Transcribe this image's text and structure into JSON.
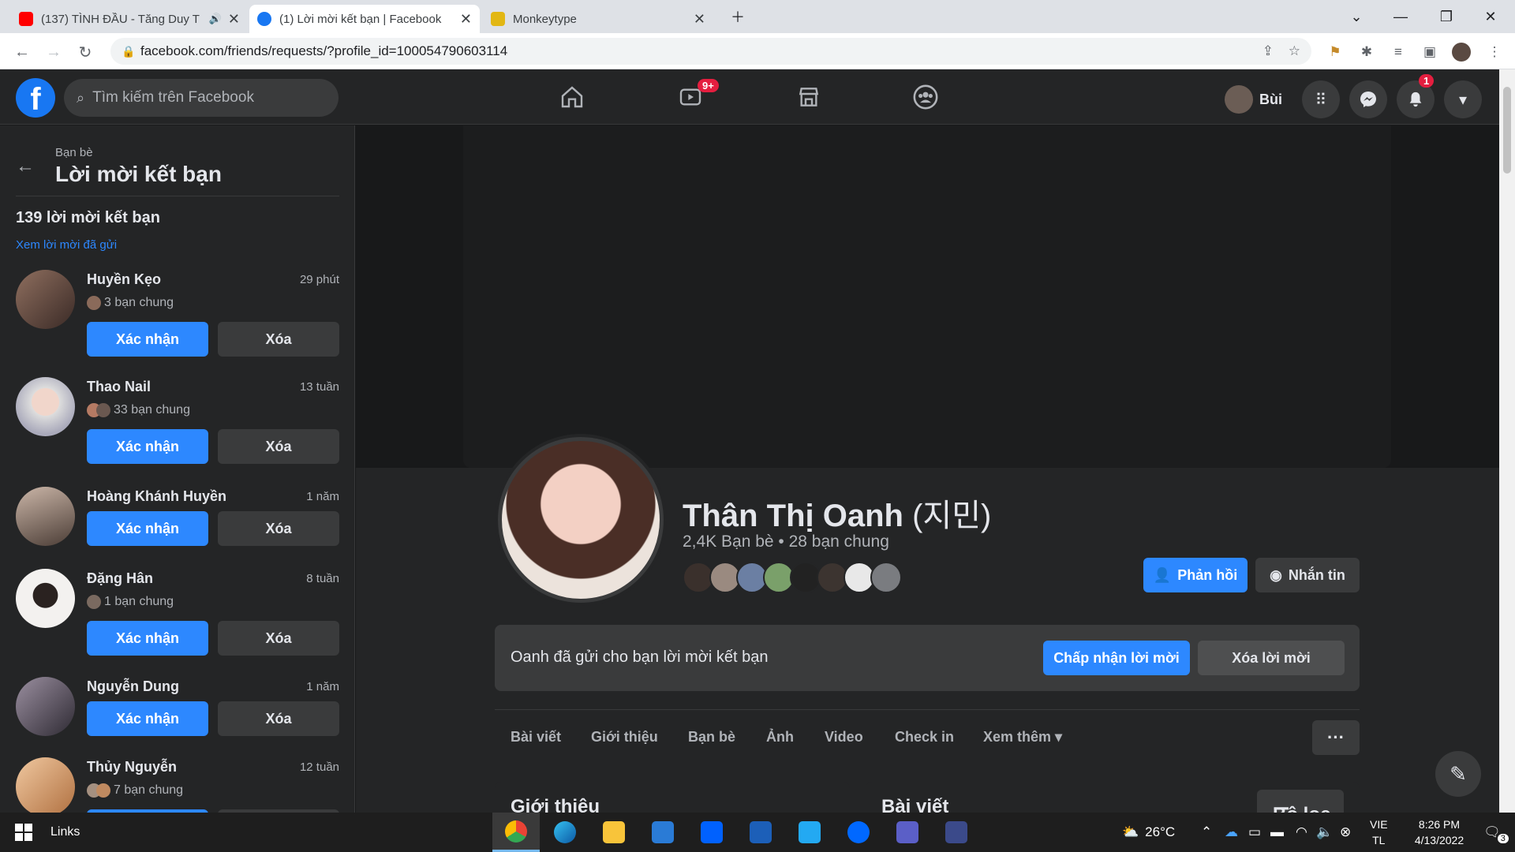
{
  "browser": {
    "tabs": [
      {
        "title": "(137) TÌNH ĐẦU - Tăng Duy T",
        "favicon_color": "#ff0000"
      },
      {
        "title": "(1) Lời mời kết bạn | Facebook",
        "favicon_color": "#1877f2"
      },
      {
        "title": "Monkeytype",
        "favicon_color": "#e2b714"
      }
    ],
    "url": "facebook.com/friends/requests/?profile_id=100054790603114"
  },
  "fb_nav": {
    "search_placeholder": "Tìm kiếm trên Facebook",
    "watch_badge": "9+",
    "user_name": "Bùi",
    "notif_badge": "1"
  },
  "sidebar": {
    "breadcrumb": "Bạn bè",
    "title": "Lời mời kết bạn",
    "count_label": "139 lời mời kết bạn",
    "sent_link": "Xem lời mời đã gửi",
    "confirm_label": "Xác nhận",
    "delete_label": "Xóa",
    "requests": [
      {
        "name": "Huyền Kẹo",
        "time": "29 phút",
        "mutual": "3 bạn chung"
      },
      {
        "name": "Thao Nail",
        "time": "13 tuần",
        "mutual": "33 bạn chung"
      },
      {
        "name": "Hoàng Khánh Huyền",
        "time": "1 năm",
        "mutual": ""
      },
      {
        "name": "Đặng Hân",
        "time": "8 tuần",
        "mutual": "1 bạn chung"
      },
      {
        "name": "Nguyễn Dung",
        "time": "1 năm",
        "mutual": ""
      },
      {
        "name": "Thủy Nguyễn",
        "time": "12 tuần",
        "mutual": "7 bạn chung"
      }
    ]
  },
  "profile": {
    "name": "Thân Thị Oanh",
    "alt_name": "(지민)",
    "meta": "2,4K Bạn bè • 28 bạn chung",
    "respond_label": "Phản hồi",
    "message_label": "Nhắn tin",
    "request_text": "Oanh đã gửi cho bạn lời mời kết bạn",
    "accept_label": "Chấp nhận lời mời",
    "decline_label": "Xóa lời mời",
    "tabs": [
      "Bài viết",
      "Giới thiệu",
      "Bạn bè",
      "Ảnh",
      "Video",
      "Check in",
      "Xem thêm"
    ],
    "intro_heading": "Giới thiệu",
    "posts_heading": "Bài viết",
    "filter_label": "Bộ lọc"
  },
  "taskbar": {
    "links_label": "Links",
    "weather": "26°C",
    "lang_top": "VIE",
    "lang_bottom": "TL",
    "time": "8:26 PM",
    "date": "4/13/2022",
    "notif_count": "3"
  }
}
